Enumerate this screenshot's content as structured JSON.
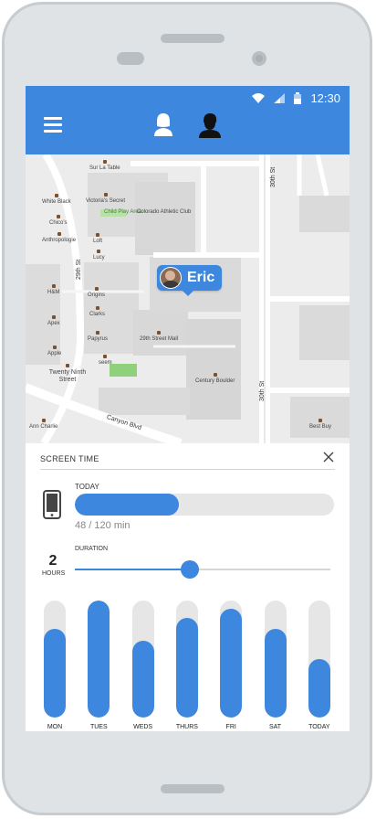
{
  "status_bar": {
    "time": "12:30"
  },
  "map": {
    "eric_label": "Eric",
    "places": [
      {
        "name": "Sur La Table"
      },
      {
        "name": "Victoria's Secret"
      },
      {
        "name": "White Black"
      },
      {
        "name": "Child Play Area"
      },
      {
        "name": "Colorado Athletic Club"
      },
      {
        "name": "Chico's"
      },
      {
        "name": "Anthropologie"
      },
      {
        "name": "Loft"
      },
      {
        "name": "Lucy"
      },
      {
        "name": "H&M"
      },
      {
        "name": "Origins"
      },
      {
        "name": "Apex"
      },
      {
        "name": "Clarks"
      },
      {
        "name": "Papyrus"
      },
      {
        "name": "29th Street Mall"
      },
      {
        "name": "Apple"
      },
      {
        "name": "seem"
      },
      {
        "name": "Twenty Ninth Street"
      },
      {
        "name": "Century Boulder"
      },
      {
        "name": "Best Buy"
      },
      {
        "name": "Ann Charlie"
      }
    ],
    "streets": {
      "s29th": "29th St",
      "s30th_a": "30th St",
      "s30th_b": "30th St",
      "canyon": "Canyon Blvd"
    }
  },
  "sheet": {
    "title": "SCREEN TIME",
    "today_label": "TODAY",
    "usage_text": "48 / 120 min",
    "used": 48,
    "limit": 120,
    "duration_label": "DURATION",
    "duration_value": "2",
    "duration_unit": "HOURS",
    "duration_fraction": 0.45
  },
  "weekly": [
    {
      "day": "MON",
      "value": 0.76
    },
    {
      "day": "TUES",
      "value": 1.0
    },
    {
      "day": "WEDS",
      "value": 0.66
    },
    {
      "day": "THURS",
      "value": 0.85
    },
    {
      "day": "FRI",
      "value": 0.93
    },
    {
      "day": "SAT",
      "value": 0.76
    },
    {
      "day": "TODAY",
      "value": 0.5
    }
  ],
  "colors": {
    "accent": "#3d87df",
    "track": "#e6e6e6"
  },
  "icons": [
    "hamburger-menu-icon",
    "female-profile-icon",
    "male-profile-icon",
    "wifi-icon",
    "signal-icon",
    "battery-icon",
    "close-icon",
    "phone-device-icon"
  ]
}
